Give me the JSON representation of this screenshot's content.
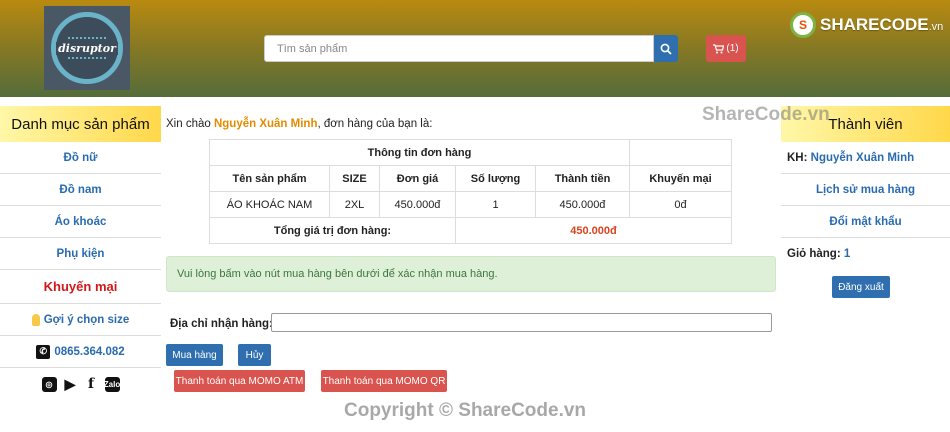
{
  "header": {
    "logo_text": "disruptor",
    "search_placeholder": "Tìm sản phẩm",
    "cart_label": "(1)",
    "brand_name": "SHARECODE",
    "brand_suffix": ".vn"
  },
  "sidebar_left": {
    "title": "Danh mục sản phẩm",
    "items": [
      "Đồ nữ",
      "Đồ nam",
      "Áo khoác",
      "Phụ kiện"
    ],
    "promo": "Khuyến mại",
    "size_hint": "Gợi ý chọn size",
    "phone": "0865.364.082",
    "zalo_label": "Zalo"
  },
  "main": {
    "greeting_prefix": "Xin chào",
    "user_name": "Nguyễn Xuân Minh",
    "greeting_suffix": ", đơn hàng của bạn là:",
    "table": {
      "title": "Thông tin đơn hàng",
      "headers": [
        "Tên sản phẩm",
        "SIZE",
        "Đơn giá",
        "Số lượng",
        "Thành tiền",
        "Khuyến mại"
      ],
      "row": [
        "ÁO KHOÁC NAM",
        "2XL",
        "450.000đ",
        "1",
        "450.000đ",
        "0đ"
      ],
      "total_label": "Tổng giá trị đơn hàng:",
      "total_value": "450.000đ"
    },
    "alert": "Vui lòng bấm vào nút mua hàng bên dưới để xác nhận mua hàng.",
    "address_label": "Địa chỉ nhận hàng:",
    "address_value": "",
    "buy_label": "Mua hàng",
    "cancel_label": "Hủy",
    "momo_atm_label": "Thanh toán qua MOMO ATM",
    "momo_qr_label": "Thanh toán qua MOMO QR"
  },
  "sidebar_right": {
    "title": "Thành viên",
    "kh_label": "KH:",
    "kh_name": "Nguyễn Xuân Minh",
    "history": "Lịch sử mua hàng",
    "change_password": "Đổi mật khẩu",
    "cart_label": "Giỏ hàng:",
    "cart_count": "1",
    "logout": "Đăng xuất"
  },
  "watermarks": {
    "top": "ShareCode.vn",
    "bottom": "Copyright © ShareCode.vn"
  },
  "colors": {
    "accent_blue": "#2f6fb0",
    "accent_red": "#d9534f",
    "promo_red": "#d0181a",
    "name_orange": "#e38b00"
  }
}
